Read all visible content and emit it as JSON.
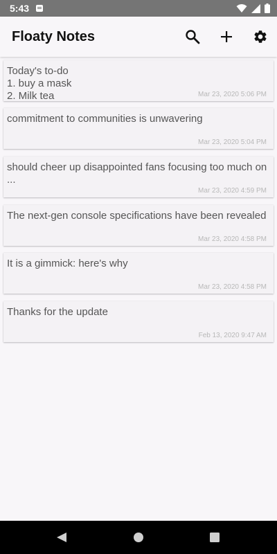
{
  "status_bar": {
    "time": "5:43"
  },
  "app_bar": {
    "title": "Floaty Notes",
    "actions": [
      "search-icon",
      "add-icon",
      "settings-icon"
    ]
  },
  "notes": [
    {
      "text": "Today's to-do\n1. buy a mask\n2. Milk tea",
      "date": "Mar 23, 2020 5:06 PM"
    },
    {
      "text": "commitment to communities is unwavering",
      "date": "Mar 23, 2020 5:04 PM"
    },
    {
      "text": "should cheer up disappointed fans focusing too much on ...",
      "date": "Mar 23, 2020 4:59 PM"
    },
    {
      "text": "The next-gen console specifications have been revealed",
      "date": "Mar 23, 2020 4:58 PM"
    },
    {
      "text": "It is a gimmick: here's why",
      "date": "Mar 23, 2020 4:58 PM"
    },
    {
      "text": "Thanks for the update",
      "date": "Feb 13, 2020 9:47 AM"
    }
  ],
  "nav_bar": {
    "buttons": [
      "back-icon",
      "home-icon",
      "recents-icon"
    ]
  }
}
